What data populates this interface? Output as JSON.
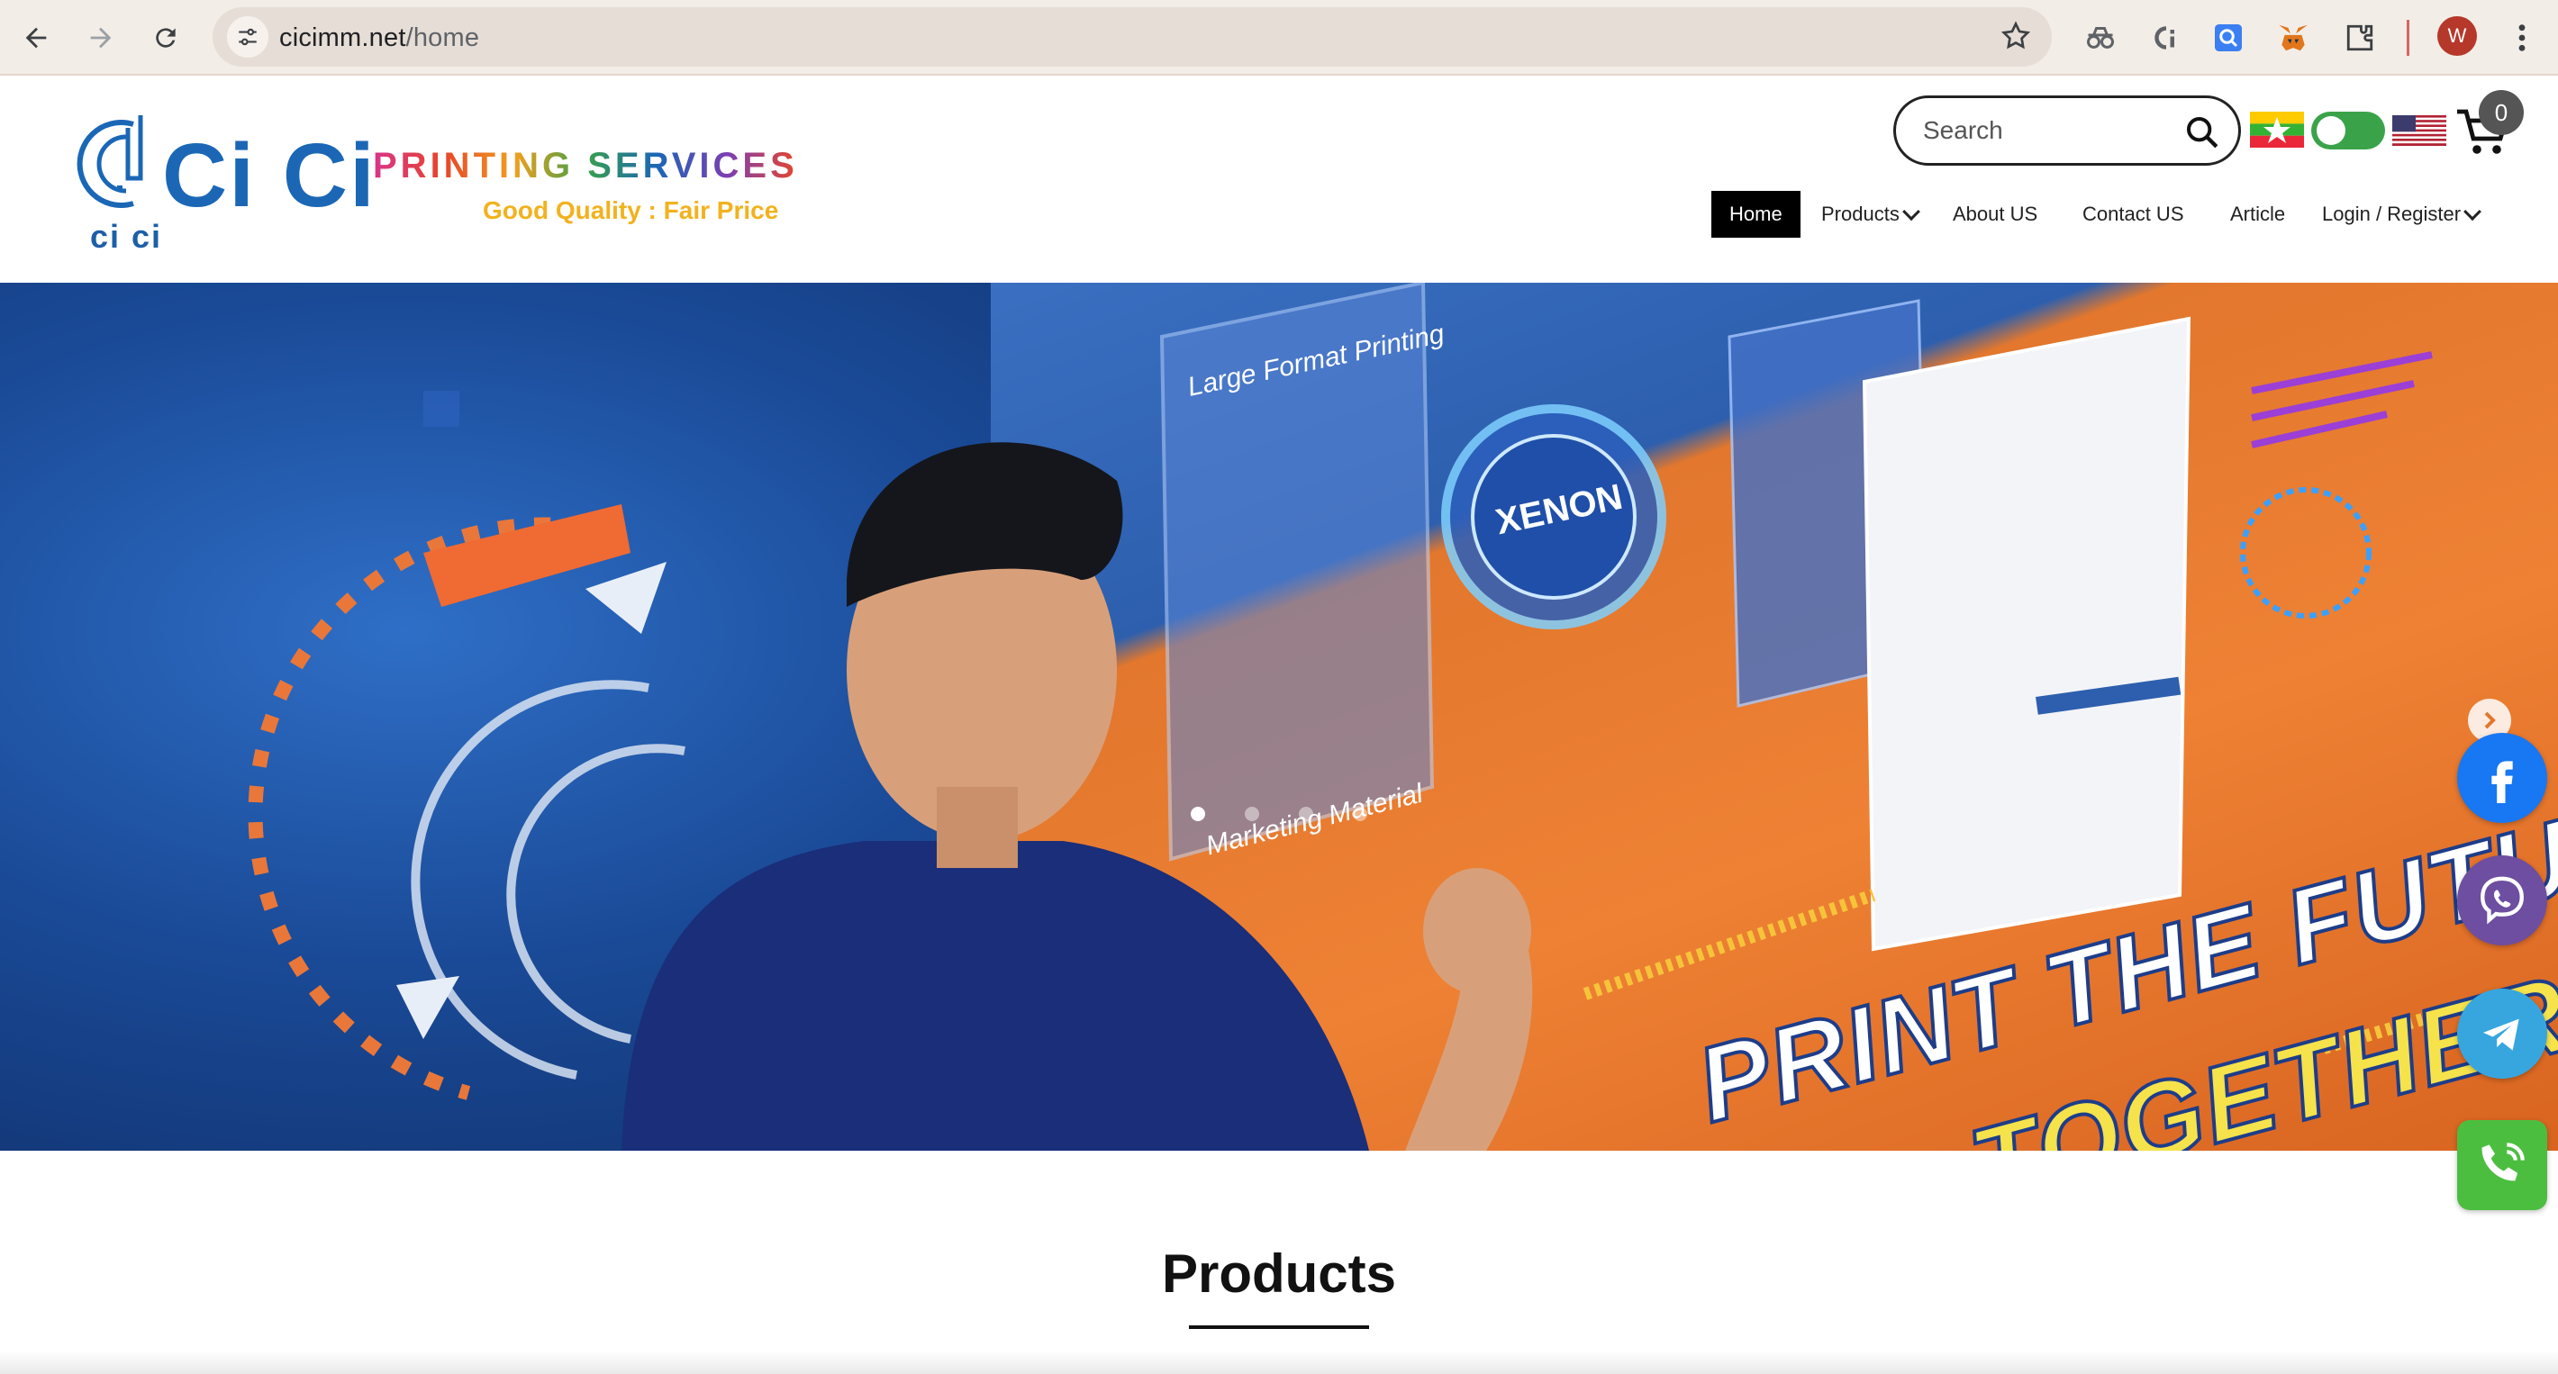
{
  "browser": {
    "url_domain": "cicimm.net",
    "url_path": "/home",
    "profile_initial": "W"
  },
  "site": {
    "logo": {
      "mark_text": "ci ci",
      "brand": "Ci Ci",
      "tagline_main": "PRINTING SERVICES",
      "tagline_sub": "Good Quality : Fair Price"
    },
    "search": {
      "placeholder": "Search"
    },
    "cart": {
      "count": "0"
    },
    "nav": [
      {
        "label": "Home",
        "active": true
      },
      {
        "label": "Products",
        "dropdown": true
      },
      {
        "label": "About US"
      },
      {
        "label": "Contact US"
      },
      {
        "label": "Article"
      },
      {
        "label": "Login / Register",
        "dropdown": true
      }
    ]
  },
  "hero": {
    "panel_1": "Large Format Printing",
    "panel_2": "Marketing Material",
    "badge": "XENON",
    "headline_1": "PRINT THE FUTURE",
    "headline_2": "TOGETHER",
    "slides": 4,
    "active_slide": 1
  },
  "social": [
    "facebook-icon",
    "viber-icon",
    "telegram-icon",
    "phone-icon"
  ],
  "section": {
    "products_title": "Products"
  },
  "colors": {
    "brand_blue": "#1b67b6",
    "orange": "#ee8134",
    "nav_active": "#000000"
  }
}
